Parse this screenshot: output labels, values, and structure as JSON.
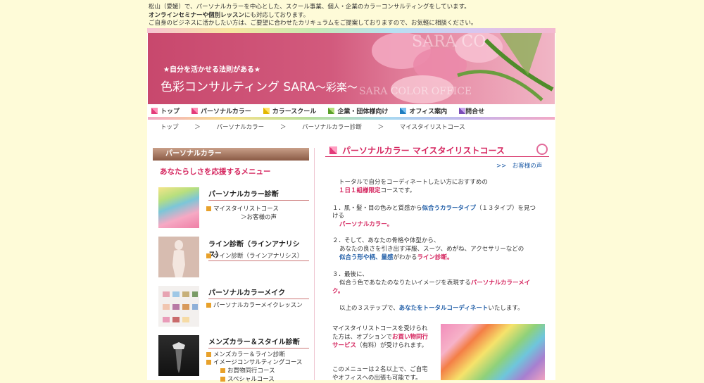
{
  "intro": {
    "line1": "松山（愛媛）で、パーソナルカラーを中心とした、スクール事業、個人・企業のカラーコンサルティングをしています。",
    "line2_bold": "オンラインセミナーや個別レッスン",
    "line2_rest": "にも対応しております。",
    "line3": "ご自身のビジネスに活かしたい方は、ご要望に合わせたカリキュラムをご提案しておりますので、お気軽に相談ください。"
  },
  "header": {
    "tagline": "★自分を活かせる法則がある★",
    "brand_main": "色彩コンサルティング SARA",
    "brand_sub": "〜彩楽〜",
    "watermark_top": "SARA CO",
    "watermark_bottom": "SARA COLOR OFFICE"
  },
  "nav": [
    {
      "label": "トップ",
      "color": "#e33b7a"
    },
    {
      "label": "パーソナルカラー",
      "color": "#e33b7a"
    },
    {
      "label": "カラースクール",
      "color": "#e2b700"
    },
    {
      "label": "企業・団体様向け",
      "color": "#5ba02a"
    },
    {
      "label": "オフィス案内",
      "color": "#1f7dbf"
    },
    {
      "label": "お問合せ",
      "color": "#7a4cb7"
    }
  ],
  "breadcrumb": [
    "トップ",
    "＞",
    "パーソナルカラー",
    "＞",
    "パーソナルカラー診断",
    "＞",
    "マイスタイリストコース"
  ],
  "sidebar": {
    "header": "パーソナルカラー",
    "subtitle": "あなたらしさを応援するメニュー",
    "sections": [
      {
        "heading": "パーソナルカラー診断",
        "links": [
          "マイスタイリストコース"
        ],
        "sub_links": [
          "お客様の声"
        ]
      },
      {
        "heading": "ライン診断（ラインアナリシス）",
        "links": [
          "ライン診断（ラインアナリシス）"
        ]
      },
      {
        "heading": "パーソナルカラーメイク",
        "links": [
          "パーソナルカラーメイクレッスン"
        ]
      },
      {
        "heading": "メンズカラー＆スタイル診断",
        "links": [
          "メンズカラー＆ライン診断",
          "イメージコンサルティングコース"
        ],
        "sub_links": [
          "お買物同行コース",
          "スペシャルコース"
        ]
      }
    ]
  },
  "main": {
    "title": "パーソナルカラー マイスタイリストコース",
    "voice_arrow": ">>",
    "voice_link": "お客様の声",
    "lead1": "トータルで自分をコーディネートしたい方におすすめの",
    "lead2_pink": "１日１組様限定",
    "lead2_rest": "コースです。",
    "step1_a": "１．肌・髪・目の色みと質感から",
    "step1_blue": "似合うカラータイプ",
    "step1_b": "（１３タイプ）を見つ",
    "step1_c": "ける",
    "step1_pink": "パーソナルカラー。",
    "step2_a": "２．そして、あなたの骨格や体型から、",
    "step2_b": "あなたの良さを引き出す洋服、スーツ、めがね、アクセサリーなどの",
    "step2_blue": "似合う形や柄、量感",
    "step2_c": "がわかる",
    "step2_pink": "ライン診断。",
    "step3_a": "３．最後に、",
    "step3_b": "似合う色であなたのなりたいイメージを表現する",
    "step3_pink1": "パーソナルカラーメイ",
    "step3_pink2": "ク。",
    "summary_a": "以上の３ステップで、",
    "summary_blue": "あなたをトータルコーディネート",
    "summary_b": "いたします。",
    "extra1": "マイスタイリストコースを受けられ",
    "extra2_a": "た方は、オプションで",
    "extra2_pink": "お買い物同行",
    "extra3_pink": "サービス",
    "extra3_rest": "（有料）が受けられます。",
    "extra4": "このメニューは２名以上で、ご自宅",
    "extra5": "やオフィスへの出張も可能です。"
  }
}
